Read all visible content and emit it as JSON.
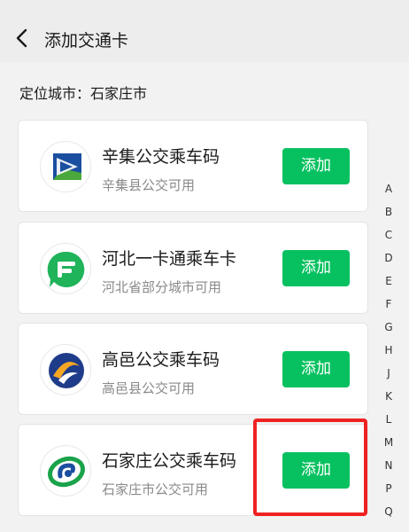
{
  "header": {
    "title": "添加交通卡",
    "back_icon": "chevron-left-icon"
  },
  "location": {
    "text": "定位城市：石家庄市"
  },
  "cards": [
    {
      "title": "辛集公交乘车码",
      "subtitle": "辛集县公交可用",
      "button": "添加"
    },
    {
      "title": "河北一卡通乘车卡",
      "subtitle": "河北省部分城市可用",
      "button": "添加"
    },
    {
      "title": "高邑公交乘车码",
      "subtitle": "高邑县公交可用",
      "button": "添加"
    },
    {
      "title": "石家庄公交乘车码",
      "subtitle": "石家庄市公交可用",
      "button": "添加"
    }
  ],
  "alphabet": [
    "A",
    "B",
    "C",
    "D",
    "E",
    "F",
    "G",
    "H",
    "J",
    "K",
    "L",
    "M",
    "N",
    "P",
    "Q"
  ],
  "colors": {
    "accent": "#07c160",
    "highlight": "#ee2222"
  }
}
